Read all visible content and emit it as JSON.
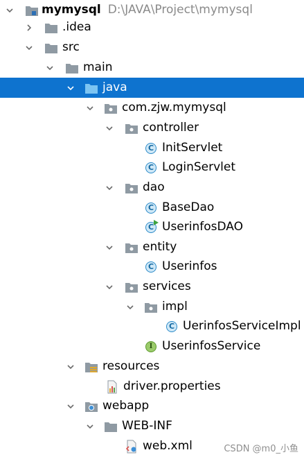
{
  "project": {
    "name": "mymysql",
    "path": "D:\\JAVA\\Project\\mymysql"
  },
  "tree": {
    "idea": ".idea",
    "src": "src",
    "main": "main",
    "java": "java",
    "package": "com.zjw.mymysql",
    "controller": "controller",
    "init_servlet": "InitServlet",
    "login_servlet": "LoginServlet",
    "dao": "dao",
    "base_dao": "BaseDao",
    "userinfos_dao": "UserinfosDAO",
    "entity": "entity",
    "userinfos": "Userinfos",
    "services": "services",
    "impl": "impl",
    "service_impl": "UerinfosServiceImpl",
    "service": "UserinfosService",
    "resources": "resources",
    "driver_properties": "driver.properties",
    "webapp": "webapp",
    "web_inf": "WEB-INF",
    "web_xml": "web.xml"
  },
  "icons": {
    "class_letter": "C",
    "interface_letter": "I"
  },
  "colors": {
    "selection": "#0e73cf",
    "folder": "#8f9aa3",
    "source_folder": "#4aa3df",
    "class_icon": "#2c8bc9",
    "interface_icon": "#9bcb6b"
  },
  "watermark": "CSDN @m0_小鱼"
}
